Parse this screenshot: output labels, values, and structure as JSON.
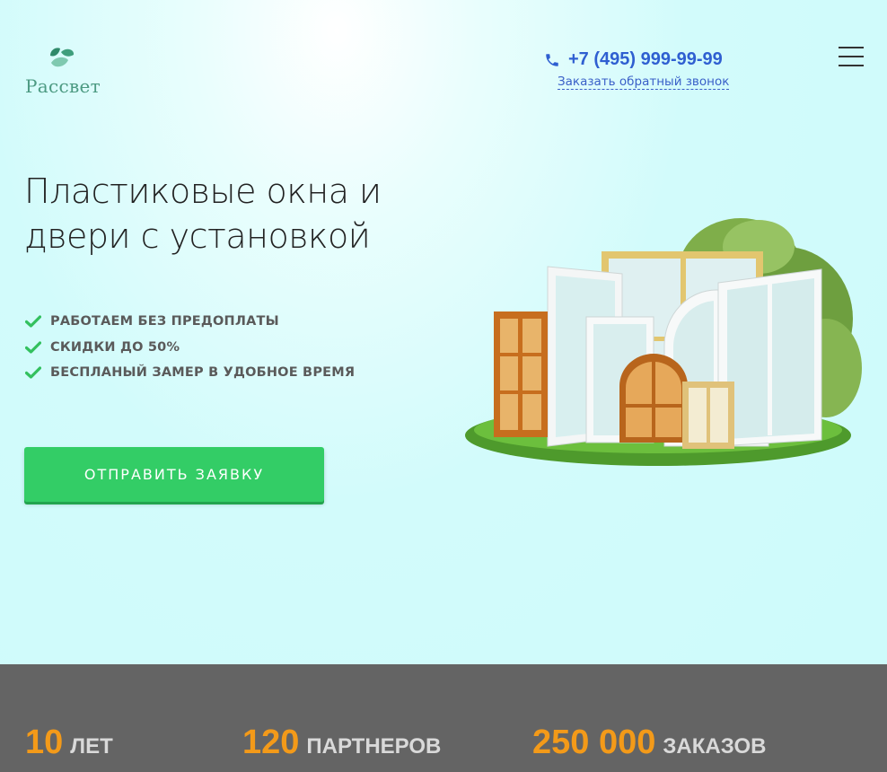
{
  "brand": {
    "name": "Рассвет"
  },
  "header": {
    "phone": "+7 (495) 999-99-99",
    "callback_link": "Заказать обратный звонок"
  },
  "hero": {
    "title": "Пластиковые окна и двери с установкой",
    "benefits": [
      "РАБОТАЕМ БЕЗ ПРЕДОПЛАТЫ",
      "СКИДКИ ДО 50%",
      "БЕСПЛАНЫЙ ЗАМЕР В УДОБНОЕ ВРЕМЯ"
    ],
    "cta_label": "ОТПРАВИТЬ ЗАЯВКУ"
  },
  "stats": [
    {
      "value": "10",
      "label": "ЛЕТ"
    },
    {
      "value": "120",
      "label": "ПАРТНЕРОВ"
    },
    {
      "value": "250 000",
      "label": "ЗАКАЗОВ"
    }
  ],
  "colors": {
    "accent_green": "#33cd66",
    "link_blue": "#2f5fd1",
    "stat_orange": "#f39a19",
    "stats_band": "#646464",
    "logo_green": "#4c9a82"
  },
  "icons": {
    "phone": "phone-icon",
    "menu": "hamburger-menu-icon",
    "check": "check-icon",
    "logo": "leaf-logo-icon"
  }
}
